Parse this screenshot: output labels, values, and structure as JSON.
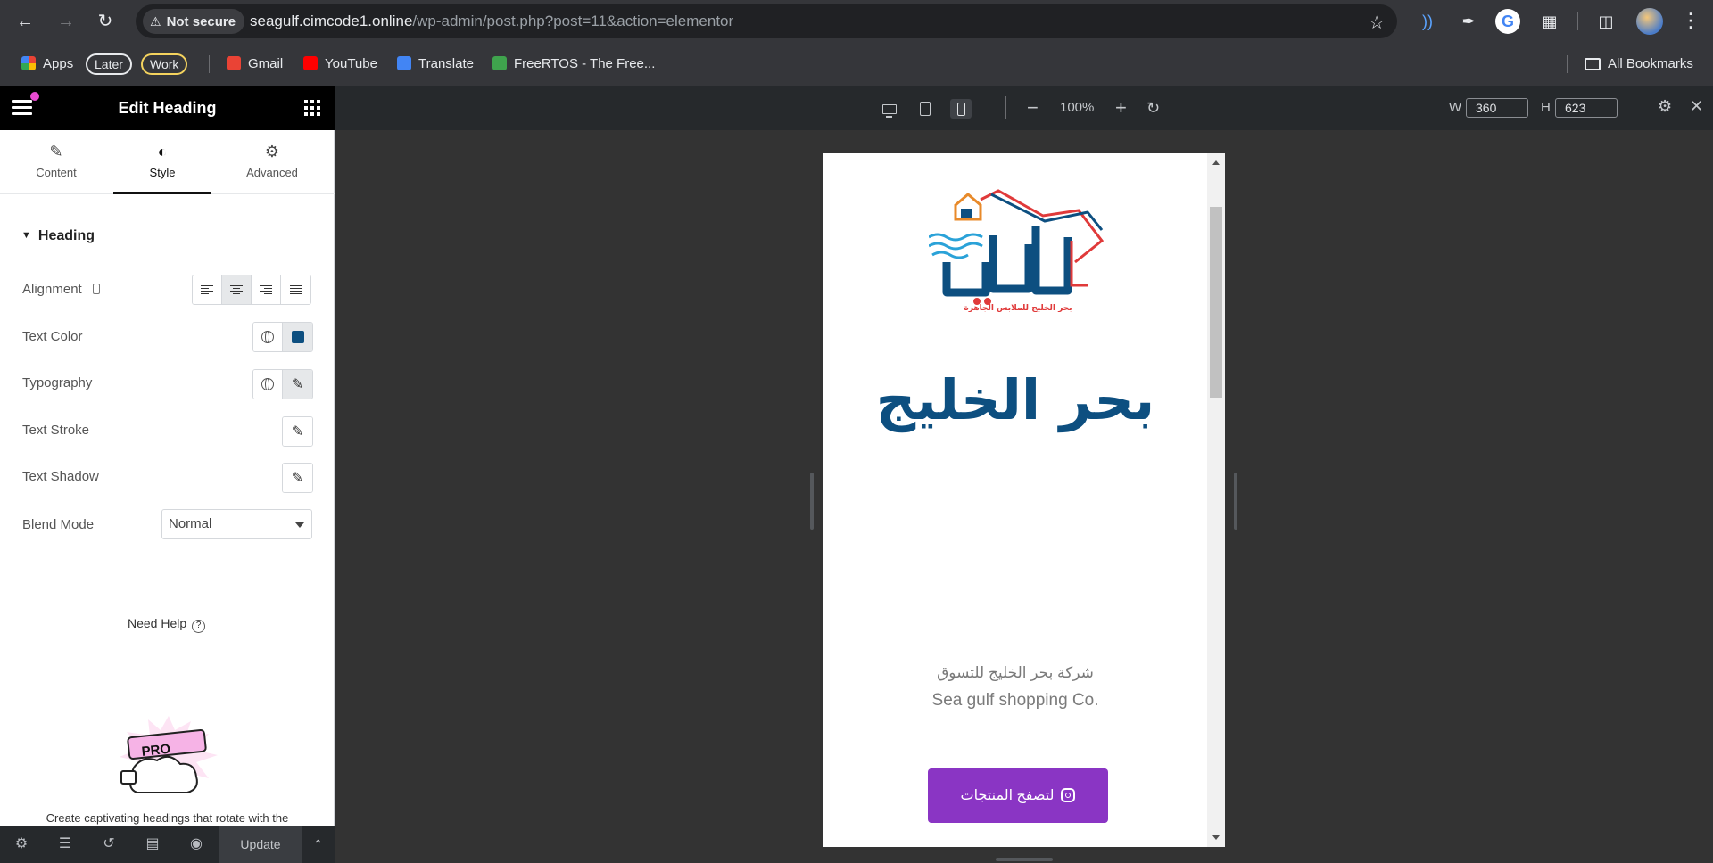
{
  "browser": {
    "security_label": "Not secure",
    "url_host": "seagulf.cimcode1.online",
    "url_path": "/wp-admin/post.php?post=11&action=elementor",
    "bookmarks": {
      "apps": "Apps",
      "later": "Later",
      "work": "Work",
      "gmail": "Gmail",
      "youtube": "YouTube",
      "translate": "Translate",
      "freertos": "FreeRTOS - The Free...",
      "all_bookmarks": "All Bookmarks"
    }
  },
  "panel": {
    "title": "Edit Heading",
    "tabs": [
      {
        "label": "Content",
        "icon": "pencil-icon"
      },
      {
        "label": "Style",
        "icon": "contrast-icon"
      },
      {
        "label": "Advanced",
        "icon": "gear-icon"
      }
    ],
    "section": "Heading",
    "controls": {
      "alignment": "Alignment",
      "text_color": "Text Color",
      "typography": "Typography",
      "text_stroke": "Text Stroke",
      "text_shadow": "Text Shadow",
      "blend_mode": "Blend Mode",
      "blend_mode_value": "Normal"
    },
    "text_color_value": "#0d4f80",
    "need_help": "Need Help",
    "promo_badge": "PRO",
    "promo_text": "Create captivating headings that rotate with the",
    "footer": {
      "update": "Update"
    }
  },
  "preview_bar": {
    "zoom": "100%",
    "width_label": "W",
    "width_value": "360",
    "height_label": "H",
    "height_value": "623"
  },
  "page": {
    "logo_tagline": "بحر الخليج للملابس الجاهزة",
    "heading": "بحر الخليج",
    "subtitle_ar": "شركة بحر الخليج للتسوق",
    "subtitle_en": "Sea gulf shopping Co.",
    "button_label": "لتصفح المنتجات",
    "button_color": "#8a35c4"
  }
}
